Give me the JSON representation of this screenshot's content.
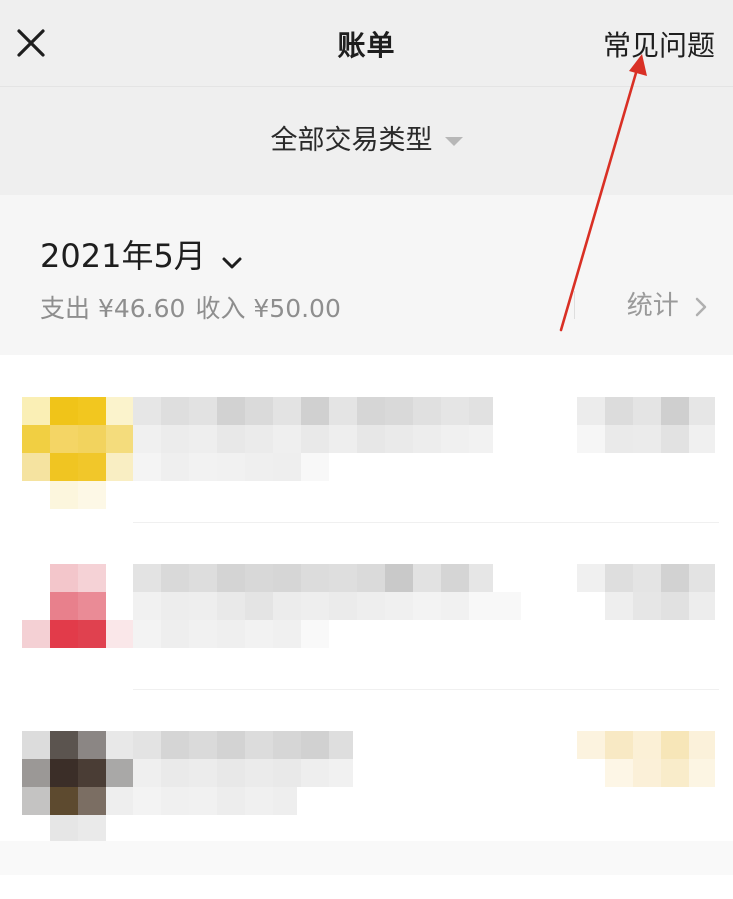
{
  "header": {
    "title": "账单",
    "faq_label": "常见问题"
  },
  "filter": {
    "label": "全部交易类型"
  },
  "month": {
    "label": "2021年5月",
    "expense": "支出 ¥46.60",
    "income": "收入 ¥50.00",
    "stats_label": "统计"
  },
  "colors": {
    "annotation_arrow": "#d93025",
    "row1_icon": "#f0c419",
    "row2_icon": "#e23b4a",
    "row3_icon": "#3b2e28",
    "row3_amount_tint": "#f7e6b8"
  },
  "icons": [
    "close-icon",
    "caret-down-icon",
    "chevron-down-icon",
    "chevron-right-icon"
  ]
}
